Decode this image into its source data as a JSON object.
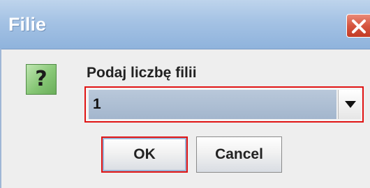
{
  "window": {
    "title": "Filie",
    "close_icon": "close-icon"
  },
  "dialog": {
    "icon": "question-icon",
    "icon_glyph": "?",
    "prompt": "Podaj liczbę filii",
    "select": {
      "selected_value": "1",
      "arrow_icon": "triangle-down-icon"
    },
    "buttons": {
      "ok_label": "OK",
      "cancel_label": "Cancel"
    }
  },
  "colors": {
    "highlight_border": "#e01414",
    "titlebar": "#a4c2e4",
    "close_button": "#d6553f"
  }
}
